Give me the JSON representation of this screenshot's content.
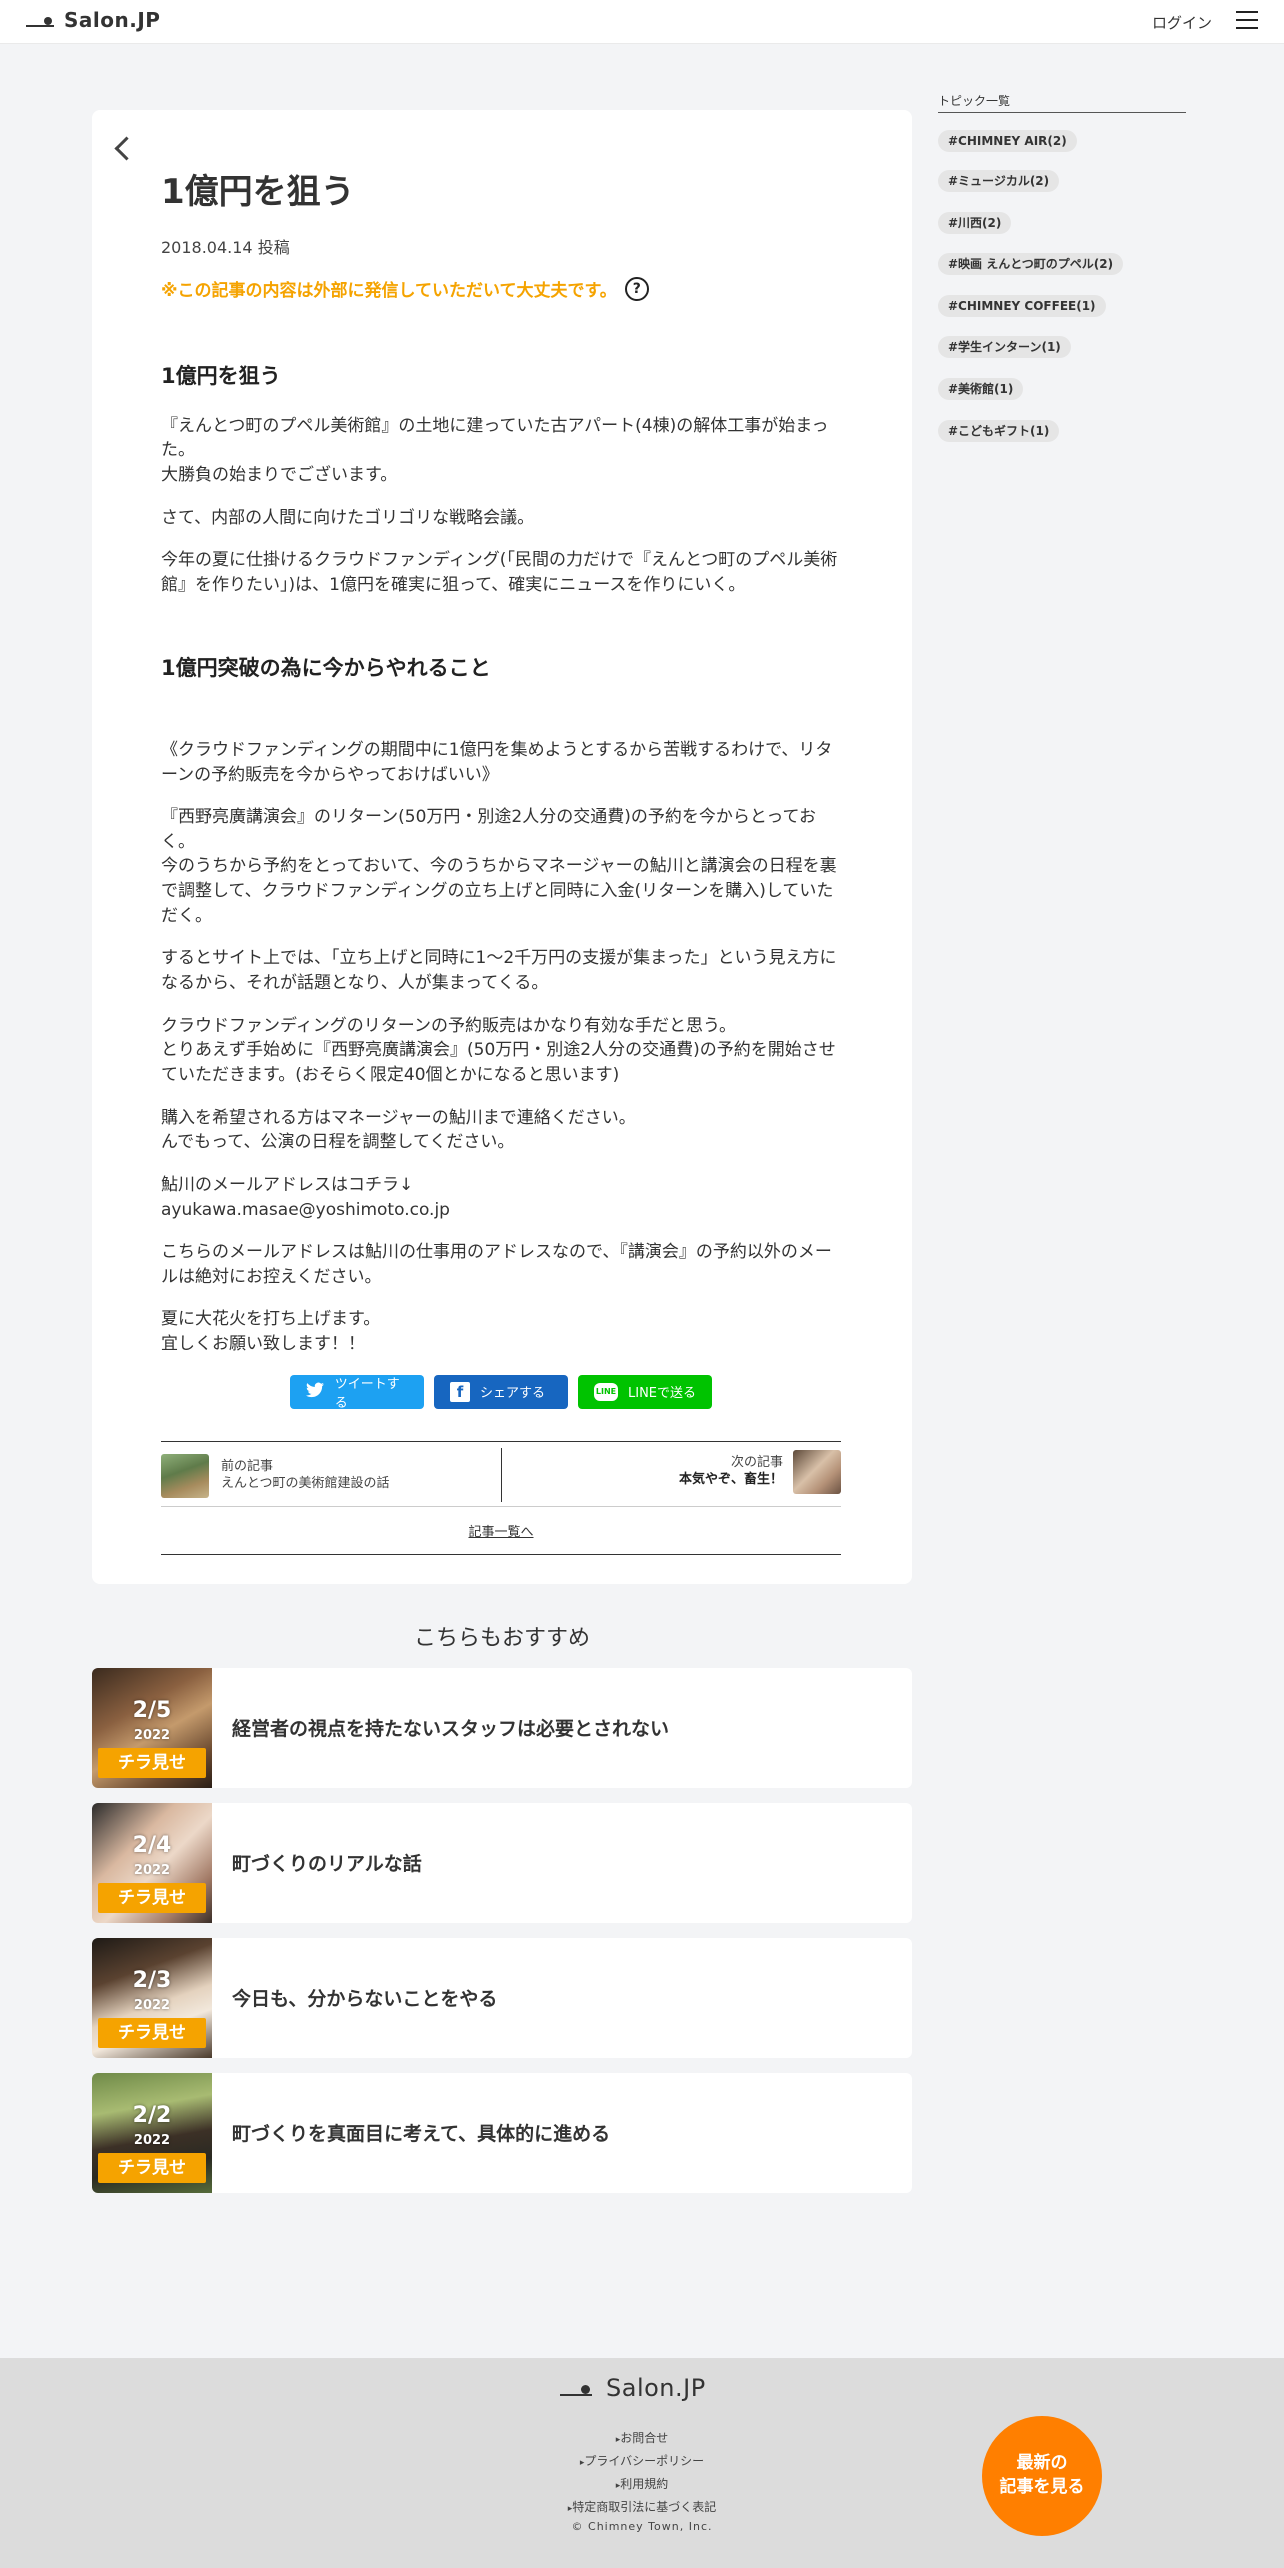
{
  "header": {
    "logo_text": "Salon.JP",
    "login_label": "ログイン"
  },
  "article": {
    "title": "1億円を狙う",
    "date": "2018.04.14 投稿",
    "notice": "※この記事の内容は外部に発信していただいて大丈夫です。",
    "notice_help": "?",
    "section1_heading": "1億円を狙う",
    "p1": "『えんとつ町のプペル美術館』の土地に建っていた古アパート(4棟)の解体工事が始まった。\n大勝負の始まりでございます。",
    "p2": "さて、内部の人間に向けたゴリゴリな戦略会議。",
    "p3": "今年の夏に仕掛けるクラウドファンディング(「民間の力だけで『えんとつ町のプペル美術館』を作りたい」)は、1億円を確実に狙って、確実にニュースを作りにいく。",
    "section2_heading": "1億円突破の為に今からやれること",
    "p4": "《クラウドファンディングの期間中に1億円を集めようとするから苦戦するわけで、リターンの予約販売を今からやっておけばいい》",
    "p5": "『西野亮廣講演会』のリターン(50万円・別途2人分の交通費)の予約を今からとっておく。\n今のうちから予約をとっておいて、今のうちからマネージャーの鮎川と講演会の日程を裏で調整して、クラウドファンディングの立ち上げと同時に入金(リターンを購入)していただく。",
    "p6": "するとサイト上では、「立ち上げと同時に1～2千万円の支援が集まった」という見え方になるから、それが話題となり、人が集まってくる。",
    "p7": "クラウドファンディングのリターンの予約販売はかなり有効な手だと思う。\nとりあえず手始めに『西野亮廣講演会』(50万円・別途2人分の交通費)の予約を開始させていただきます。(おそらく限定40個とかになると思います)",
    "p8": "購入を希望される方はマネージャーの鮎川まで連絡ください。\nんでもって、公演の日程を調整してください。",
    "p9": "鮎川のメールアドレスはコチラ↓\nayukawa.masae@yoshimoto.co.jp",
    "p10": "こちらのメールアドレスは鮎川の仕事用のアドレスなので、『講演会』の予約以外のメールは絶対にお控えください。",
    "p11": "夏に大花火を打ち上げます。\n宜しくお願い致します！！"
  },
  "share": {
    "tweet": "ツイートする",
    "facebook": "シェアする",
    "line": "LINEで送る",
    "line_icon": "LINE"
  },
  "pager": {
    "prev_label": "前の記事",
    "prev_title": "えんとつ町の美術館建設の話",
    "next_label": "次の記事",
    "next_title": "本気やぞ、畜生！",
    "all_link": "記事一覧へ"
  },
  "recommended": {
    "title": "こちらもおすすめ",
    "badge": "チラ見せ",
    "items": [
      {
        "date": "2/5",
        "year": "2022",
        "title": "経営者の視点を持たないスタッフは必要とされない"
      },
      {
        "date": "2/4",
        "year": "2022",
        "title": "町づくりのリアルな話"
      },
      {
        "date": "2/3",
        "year": "2022",
        "title": "今日も、分からないことをやる"
      },
      {
        "date": "2/2",
        "year": "2022",
        "title": "町づくりを真面目に考えて、具体的に進める"
      }
    ]
  },
  "sidebar": {
    "title": "トピック一覧",
    "tags": [
      "#CHIMNEY AIR(2)",
      "#ミュージカル(2)",
      "#川西(2)",
      "#映画 えんとつ町のプペル(2)",
      "#CHIMNEY COFFEE(1)",
      "#学生インターン(1)",
      "#美術館(1)",
      "#こどもギフト(1)"
    ]
  },
  "footer": {
    "logo_text": "Salon.JP",
    "links": [
      "お問合せ",
      "プライバシーポリシー",
      "利用規約",
      "特定商取引法に基づく表記"
    ],
    "copyright": "© Chimney Town, Inc.",
    "newest_line1": "最新の",
    "newest_line2": "記事を見る"
  },
  "colors": {
    "accent_orange": "#f5a300",
    "newest_button": "#ff7f00",
    "twitter": "#1da1f2",
    "facebook": "#1766c0",
    "line": "#00c300"
  }
}
